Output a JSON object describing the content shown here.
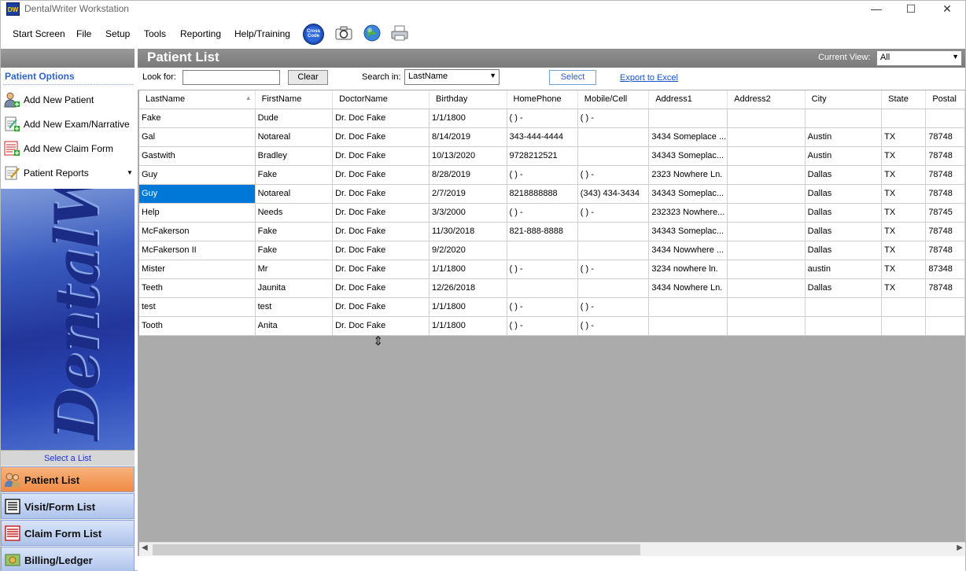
{
  "window": {
    "title": "DentalWriter Workstation",
    "icon_text": "DW",
    "controls": [
      "—",
      "☐",
      "✕"
    ]
  },
  "menu": [
    "Start Screen",
    "File",
    "Setup",
    "Tools",
    "Reporting",
    "Help/Training"
  ],
  "toolbar_icons": [
    "cross-code-icon",
    "camera-icon",
    "globe-icon",
    "printer-icon"
  ],
  "toolbar_badge_text": "Cross Code",
  "sidebar": {
    "options_title": "Patient Options",
    "options": [
      "Add New Patient",
      "Add New Exam/Narrative",
      "Add New Claim Form",
      "Patient Reports"
    ],
    "banner_text": "DentalWriter",
    "select_list_label": "Select a List",
    "lists": [
      "Patient List",
      "Visit/Form List",
      "Claim Form List",
      "Billing/Ledger"
    ]
  },
  "main": {
    "title": "Patient List",
    "current_view_label": "Current View:",
    "current_view_value": "All",
    "look_for_label": "Look for:",
    "look_for_value": "",
    "clear_label": "Clear",
    "search_in_label": "Search in:",
    "search_in_value": "LastName",
    "select_label": "Select",
    "export_label": "Export to Excel"
  },
  "table": {
    "columns": [
      "LastName",
      "FirstName",
      "DoctorName",
      "Birthday",
      "HomePhone",
      "Mobile/Cell",
      "Address1",
      "Address2",
      "City",
      "State",
      "Postal"
    ],
    "sorted_column": "LastName",
    "selected_row": 4,
    "rows": [
      [
        "Fake",
        "Dude",
        "Dr. Doc Fake",
        "1/1/1800",
        "(  )   -",
        "(  )   -",
        "",
        "",
        "",
        "",
        ""
      ],
      [
        "Gal",
        "Notareal",
        "Dr. Doc Fake",
        "8/14/2019",
        "343-444-4444",
        "",
        "3434 Someplace ...",
        "",
        "Austin",
        "TX",
        "78748"
      ],
      [
        "Gastwith",
        "Bradley",
        "Dr. Doc Fake",
        "10/13/2020",
        "9728212521",
        "",
        "34343 Someplac...",
        "",
        "Austin",
        "TX",
        "78748"
      ],
      [
        "Guy",
        "Fake",
        "Dr. Doc Fake",
        "8/28/2019",
        "(  )   -",
        "(  )   -",
        "2323 Nowhere Ln.",
        "",
        "Dallas",
        "TX",
        "78748"
      ],
      [
        "Guy",
        "Notareal",
        "Dr. Doc Fake",
        "2/7/2019",
        "8218888888",
        "(343) 434-3434",
        "34343 Someplac...",
        "",
        "Dallas",
        "TX",
        "78748"
      ],
      [
        "Help",
        "Needs",
        "Dr. Doc Fake",
        "3/3/2000",
        "(  )   -",
        "(  )   -",
        "232323 Nowhere...",
        "",
        "Dallas",
        "TX",
        "78745"
      ],
      [
        "McFakerson",
        "Fake",
        "Dr. Doc Fake",
        "11/30/2018",
        "821-888-8888",
        "",
        "34343 Someplac...",
        "",
        "Dallas",
        "TX",
        "78748"
      ],
      [
        "McFakerson II",
        "Fake",
        "Dr. Doc Fake",
        "9/2/2020",
        "",
        "",
        "3434 Nowwhere ...",
        "",
        "Dallas",
        "TX",
        "78748"
      ],
      [
        "Mister",
        "Mr",
        "Dr. Doc Fake",
        "1/1/1800",
        "(  )   -",
        "(  )   -",
        "3234 nowhere ln.",
        "",
        "austin",
        "TX",
        "87348"
      ],
      [
        "Teeth",
        "Jaunita",
        "Dr. Doc Fake",
        "12/26/2018",
        "",
        "",
        "3434 Nowhere Ln.",
        "",
        "Dallas",
        "TX",
        "78748"
      ],
      [
        "test",
        "test",
        "Dr. Doc Fake",
        "1/1/1800",
        "(  )   -",
        "(  )   -",
        "",
        "",
        "",
        "",
        ""
      ],
      [
        "Tooth",
        "Anita",
        "Dr. Doc Fake",
        "1/1/1800",
        "(  )   -",
        "(  )   -",
        "",
        "",
        "",
        "",
        ""
      ]
    ]
  }
}
